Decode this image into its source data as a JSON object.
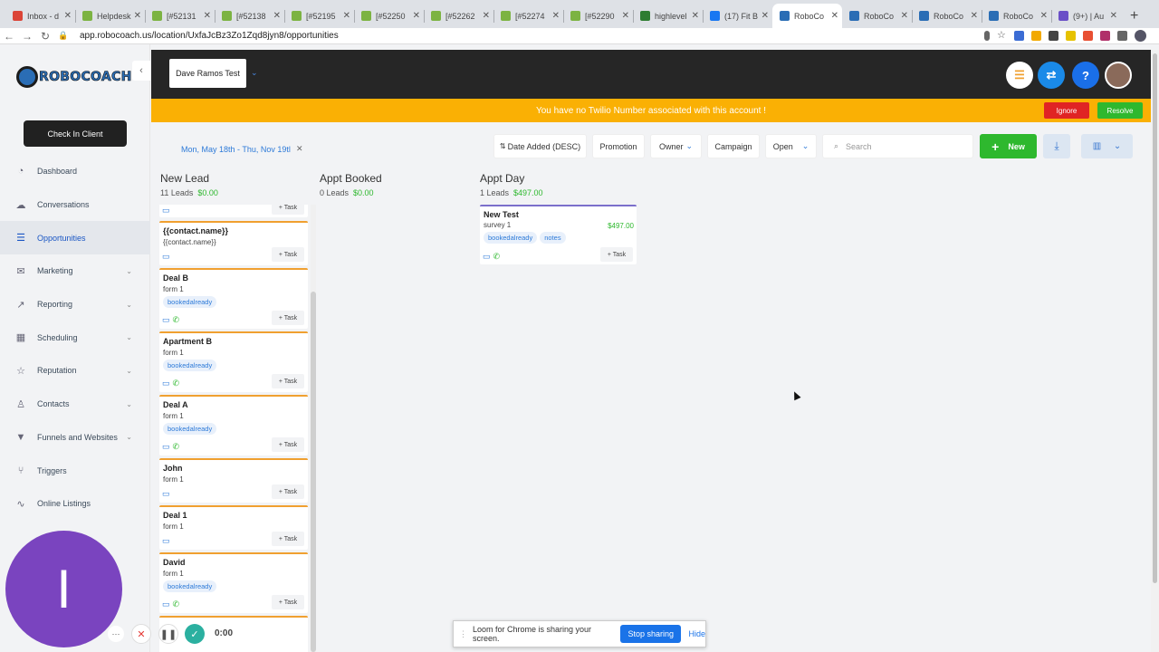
{
  "browser": {
    "tabs": [
      {
        "title": "Inbox - d",
        "color": "#db4437",
        "active": false
      },
      {
        "title": "Helpdesk",
        "color": "#7cb342",
        "active": false
      },
      {
        "title": "[#52131",
        "color": "#7cb342",
        "active": false
      },
      {
        "title": "[#52138",
        "color": "#7cb342",
        "active": false
      },
      {
        "title": "[#52195",
        "color": "#7cb342",
        "active": false
      },
      {
        "title": "[#52250",
        "color": "#7cb342",
        "active": false
      },
      {
        "title": "[#52262",
        "color": "#7cb342",
        "active": false
      },
      {
        "title": "[#52274",
        "color": "#7cb342",
        "active": false
      },
      {
        "title": "[#52290",
        "color": "#7cb342",
        "active": false
      },
      {
        "title": "highlevel",
        "color": "#2e7d32",
        "active": false
      },
      {
        "title": "(17) Fit B",
        "color": "#1877f2",
        "active": false
      },
      {
        "title": "RoboCo",
        "color": "#2a6db5",
        "active": true
      },
      {
        "title": "RoboCo",
        "color": "#2a6db5",
        "active": false
      },
      {
        "title": "RoboCo",
        "color": "#2a6db5",
        "active": false
      },
      {
        "title": "RoboCo",
        "color": "#2a6db5",
        "active": false
      },
      {
        "title": "(9+) | Au",
        "color": "#6a4fc7",
        "active": false
      }
    ],
    "new_tab": "+",
    "url": "app.robocoach.us/location/UxfaJcBz3Zo1Zqd8jyn8/opportunities"
  },
  "sidebar": {
    "brand": "ROBOCOACH",
    "collapse_icon": "‹",
    "check_in": "Check In Client",
    "items": [
      {
        "label": "Dashboard",
        "icon": "◔",
        "active": false,
        "chevron": false
      },
      {
        "label": "Conversations",
        "icon": "☁",
        "active": false,
        "chevron": false
      },
      {
        "label": "Opportunities",
        "icon": "☰",
        "active": true,
        "chevron": false
      },
      {
        "label": "Marketing",
        "icon": "✉",
        "active": false,
        "chevron": true
      },
      {
        "label": "Reporting",
        "icon": "↗",
        "active": false,
        "chevron": true
      },
      {
        "label": "Scheduling",
        "icon": "▦",
        "active": false,
        "chevron": true
      },
      {
        "label": "Reputation",
        "icon": "☆",
        "active": false,
        "chevron": true
      },
      {
        "label": "Contacts",
        "icon": "♙",
        "active": false,
        "chevron": true
      },
      {
        "label": "Funnels and Websites",
        "icon": "▼",
        "active": false,
        "chevron": true
      },
      {
        "label": "Triggers",
        "icon": "⑂",
        "active": false,
        "chevron": false
      },
      {
        "label": "Online Listings",
        "icon": "∿",
        "active": false,
        "chevron": false
      }
    ]
  },
  "topbar": {
    "account": "Dave Ramos Test",
    "help": "?"
  },
  "warning": {
    "text": "You have no Twilio Number associated with this account !",
    "ignore": "Ignore",
    "resolve": "Resolve"
  },
  "filters": {
    "date_range": "Mon, May 18th - Thu, Nov 19tl",
    "sort": "Date Added (DESC)",
    "promotion": "Promotion",
    "owner": "Owner",
    "campaign": "Campaign",
    "status": "Open",
    "search_placeholder": "Search",
    "new": "New"
  },
  "columns": [
    {
      "title": "New Lead",
      "count": "11 Leads",
      "amount": "$0.00"
    },
    {
      "title": "Appt Booked",
      "count": "0 Leads",
      "amount": "$0.00"
    },
    {
      "title": "Appt Day",
      "count": "1 Leads",
      "amount": "$497.00"
    }
  ],
  "task_label": "+ Task",
  "new_lead_cards": [
    {
      "name": "{{contact.name}}",
      "sub": "{{contact.name}}",
      "tags": [],
      "phone": false
    },
    {
      "name": "Deal B",
      "sub": "form 1",
      "tags": [
        "bookedalready"
      ],
      "phone": true
    },
    {
      "name": "Apartment B",
      "sub": "form 1",
      "tags": [
        "bookedalready"
      ],
      "phone": true
    },
    {
      "name": "Deal A",
      "sub": "form 1",
      "tags": [
        "bookedalready"
      ],
      "phone": true
    },
    {
      "name": "John",
      "sub": "form 1",
      "tags": [],
      "phone": false
    },
    {
      "name": "Deal 1",
      "sub": "form 1",
      "tags": [],
      "phone": false
    },
    {
      "name": "David",
      "sub": "form 1",
      "tags": [
        "bookedalready"
      ],
      "phone": true
    }
  ],
  "appt_day_card": {
    "name": "New Test",
    "sub": "survey 1",
    "price": "$497.00",
    "tags": [
      "bookedalready",
      "notes"
    ]
  },
  "loom": {
    "avatar_letter": "I",
    "timer": "0:00",
    "sharing_text": "Loom for Chrome is sharing your screen.",
    "stop": "Stop sharing",
    "hide": "Hide"
  }
}
